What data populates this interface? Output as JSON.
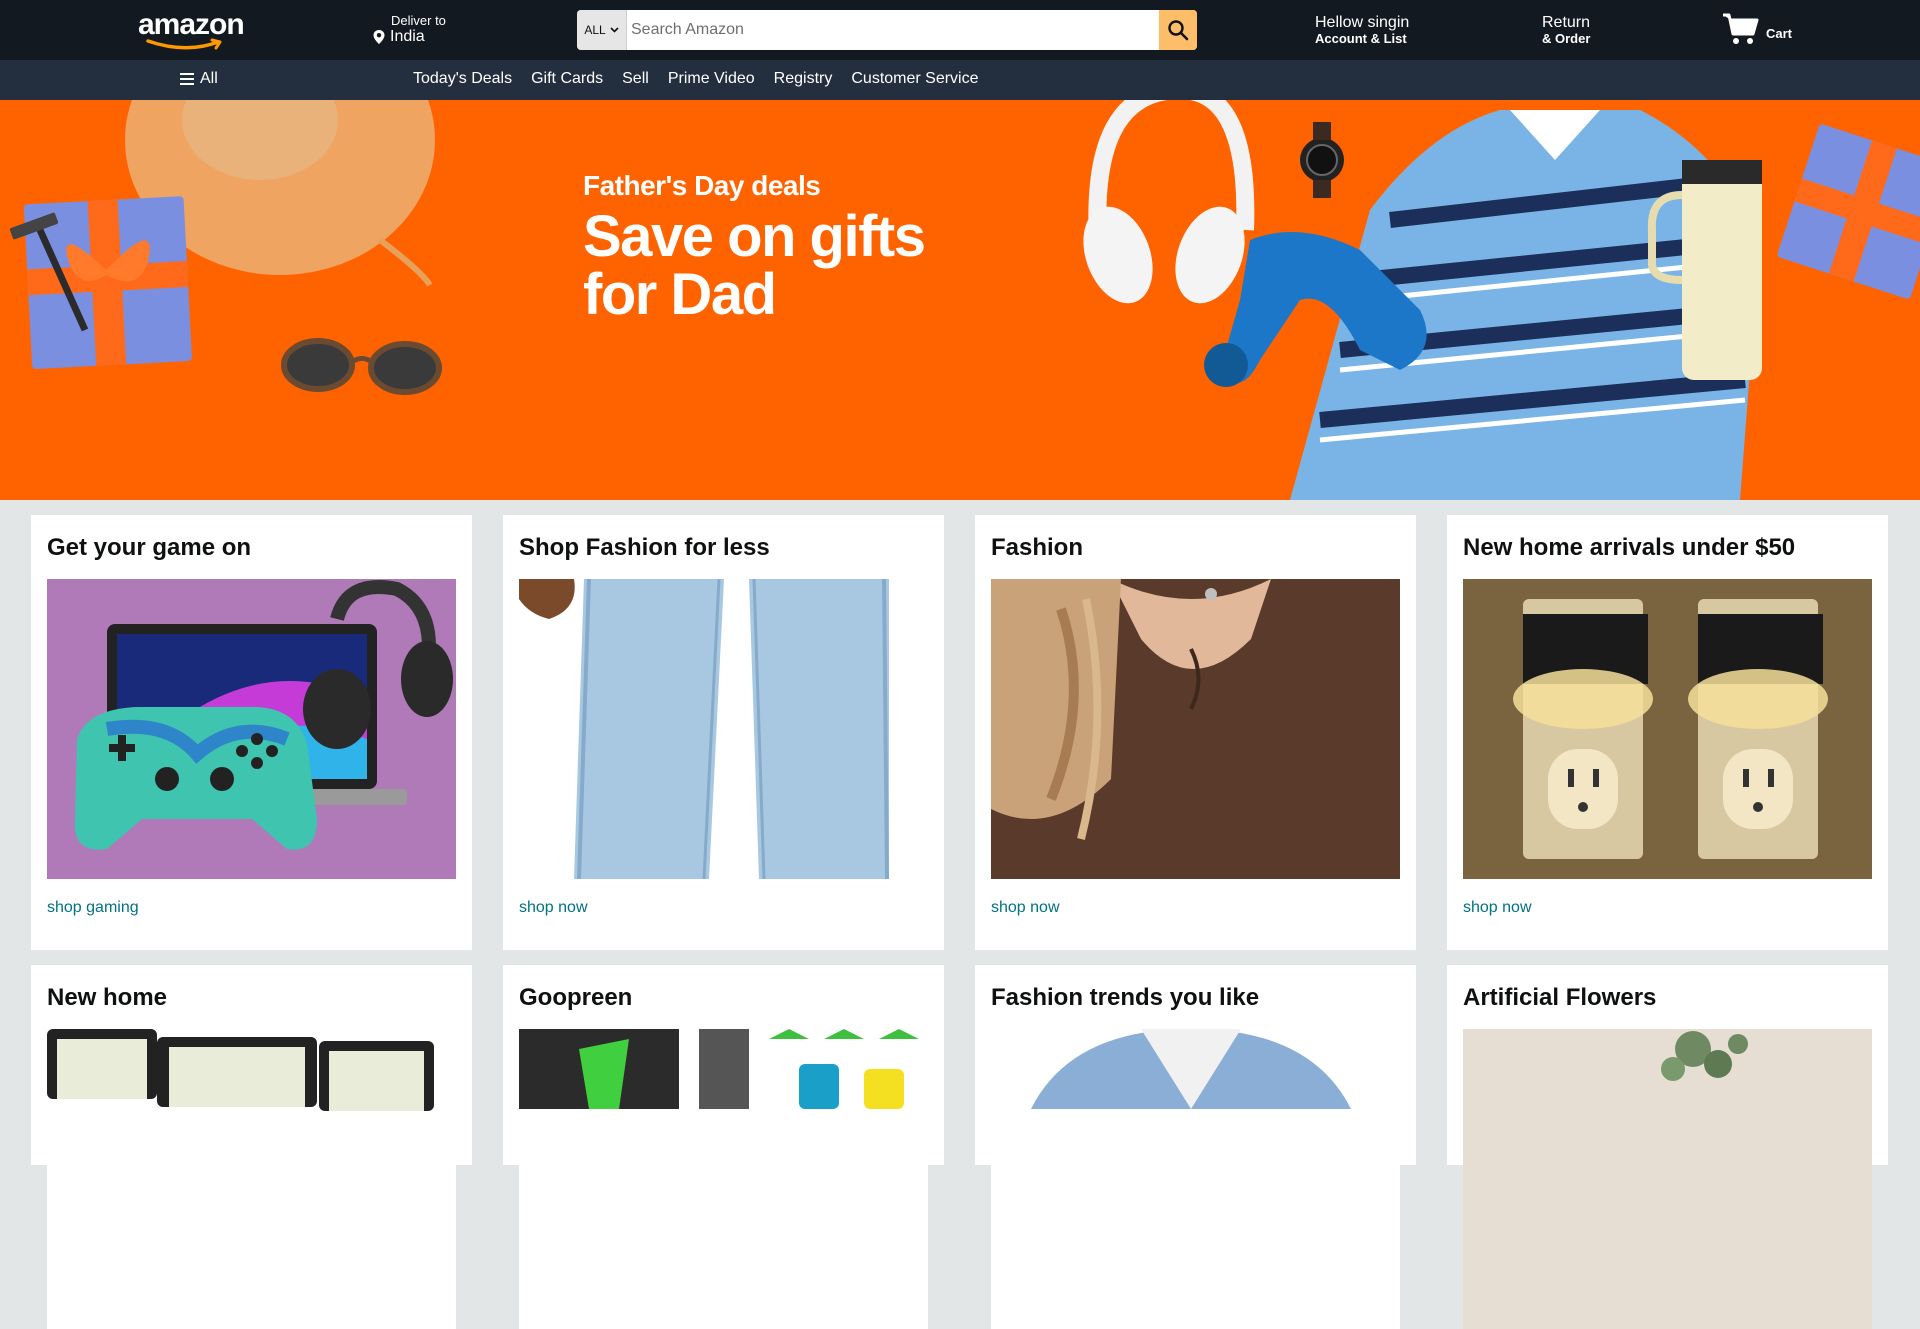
{
  "header": {
    "logo_text": "amazon",
    "deliver_label": "Deliver to",
    "deliver_location": "India",
    "search": {
      "category": "ALL",
      "placeholder": "Search Amazon"
    },
    "account_greeting": "Hellow singin",
    "account_label": "Account & List",
    "returns_label": "Return",
    "orders_label": "& Order",
    "cart_label": "Cart"
  },
  "subnav": {
    "all_label": "All",
    "links": [
      "Today's Deals",
      "Gift Cards",
      "Sell",
      "Prime Video",
      "Registry",
      "Customer Service"
    ]
  },
  "hero": {
    "kicker": "Father's Day deals",
    "title_line1": "Save on gifts",
    "title_line2": "for Dad"
  },
  "cards": [
    {
      "title": "Get your game on",
      "link": "shop gaming"
    },
    {
      "title": "Shop Fashion for less",
      "link": "shop now"
    },
    {
      "title": "Fashion",
      "link": "shop now"
    },
    {
      "title": "New home arrivals under $50",
      "link": "shop now"
    },
    {
      "title": "New home"
    },
    {
      "title": "Goopreen"
    },
    {
      "title": "Fashion trends you like"
    },
    {
      "title": "Artificial Flowers"
    }
  ],
  "colors": {
    "nav_top": "#131921",
    "nav_sub": "#232f3e",
    "search_button": "#febd69",
    "hero_bg": "#ff6300",
    "link": "#007185"
  }
}
